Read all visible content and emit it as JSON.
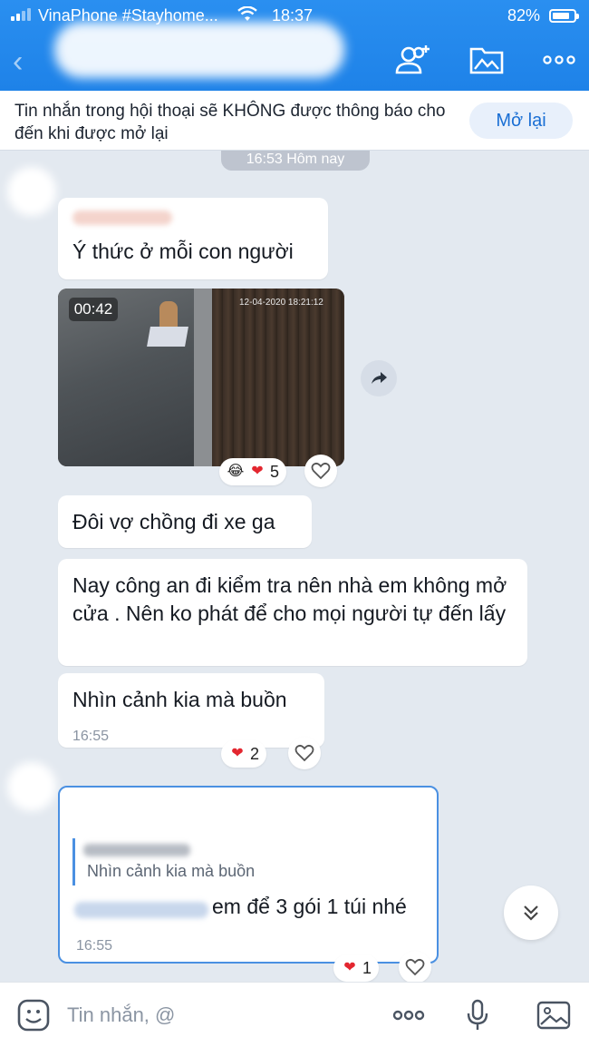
{
  "status_bar": {
    "carrier": "VinaPhone #Stayhome...",
    "time": "18:37",
    "battery": "82%",
    "icons": [
      "signal-icon",
      "wifi-icon",
      "battery-icon"
    ]
  },
  "header": {
    "icons": [
      "back-arrow-icon",
      "add-member-icon",
      "media-folder-icon",
      "more-options-icon"
    ]
  },
  "mute_banner": {
    "text": "Tin nhắn trong hội thoại sẽ KHÔNG được thông báo cho đến khi được mở lại",
    "button_label": "Mở lại"
  },
  "date_separator": "16:53 Hôm nay",
  "messages": [
    {
      "text": "Ý thức ở mỗi con người"
    },
    {
      "video_duration": "00:42",
      "video_timestamp": "12-04-2020 18:21:12",
      "reactions_count": "5"
    },
    {
      "text": "Đôi vợ chồng đi xe ga"
    },
    {
      "text": "Nay công an đi kiểm tra nên nhà em không mở cửa . Nên ko phát để cho mọi người tự đến lấy"
    },
    {
      "text": "Nhìn cảnh kia mà buồn",
      "time": "16:55",
      "reactions_count": "2"
    },
    {
      "quoted_text": "Nhìn cảnh kia mà buồn",
      "text": "em để 3 gói 1 túi nhé",
      "time": "16:55",
      "reactions_count": "1"
    }
  ],
  "composer": {
    "placeholder": "Tin nhắn, @",
    "icons": [
      "sticker-icon",
      "more-icon",
      "microphone-icon",
      "image-icon"
    ]
  },
  "colors": {
    "header_blue": "#1e82e8",
    "background": "#e3e9f0",
    "link_blue": "#1a6fd4",
    "heart_red": "#e3262f"
  }
}
